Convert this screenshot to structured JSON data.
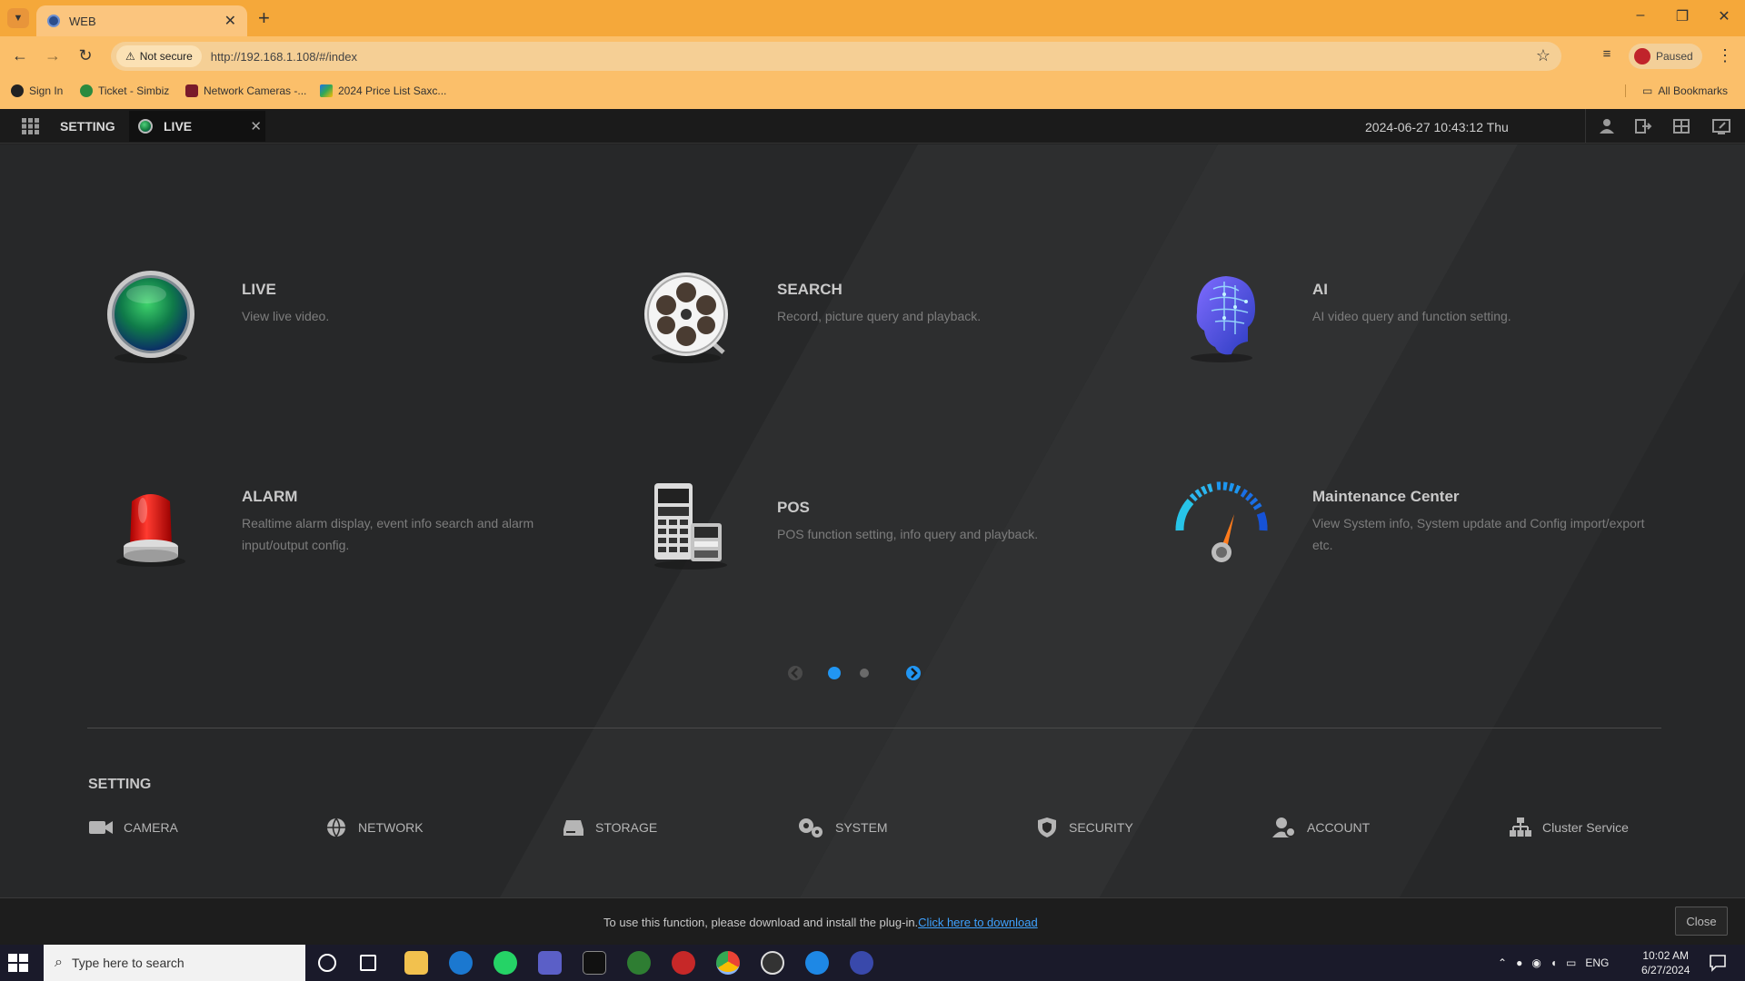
{
  "browser": {
    "tab_title": "WEB",
    "tab_close": "✕",
    "new_tab": "+",
    "window_controls": [
      "–",
      "❐",
      "✕"
    ],
    "security_label": "Not secure",
    "url": "http://192.168.1.108/#/index",
    "profile_status": "Paused",
    "bookmarks": [
      "Sign In",
      "Ticket - Simbiz",
      "Network Cameras -...",
      "2024 Price List Saxc..."
    ],
    "all_bookmarks": "All Bookmarks"
  },
  "app": {
    "setting_link": "SETTING",
    "open_tab": "LIVE",
    "open_tab_close": "✕",
    "datetime": "2024-06-27 10:43:12 Thu"
  },
  "modules": [
    {
      "title": "LIVE",
      "desc": "View live video.",
      "icon": "live-globe-icon"
    },
    {
      "title": "SEARCH",
      "desc": "Record, picture query and playback.",
      "icon": "film-reel-icon"
    },
    {
      "title": "AI",
      "desc": "AI video query and function setting.",
      "icon": "ai-brain-icon"
    },
    {
      "title": "ALARM",
      "desc": "Realtime alarm display, event info search and alarm input/output config.",
      "icon": "alarm-beacon-icon"
    },
    {
      "title": "POS",
      "desc": "POS function setting, info query and playback.",
      "icon": "pos-terminal-icon"
    },
    {
      "title": "Maintenance Center",
      "desc": "View System info, System update and Config import/export etc.",
      "icon": "gauge-icon"
    }
  ],
  "pager": {
    "pages": 2,
    "current": 1
  },
  "settings": {
    "heading": "SETTING",
    "items": [
      {
        "label": "CAMERA",
        "icon": "camera-icon"
      },
      {
        "label": "NETWORK",
        "icon": "globe-icon"
      },
      {
        "label": "STORAGE",
        "icon": "storage-icon"
      },
      {
        "label": "SYSTEM",
        "icon": "gears-icon"
      },
      {
        "label": "SECURITY",
        "icon": "shield-icon"
      },
      {
        "label": "ACCOUNT",
        "icon": "account-icon"
      },
      {
        "label": "Cluster Service",
        "icon": "cluster-icon"
      }
    ]
  },
  "plugin": {
    "message": "To use this function, please download and install the plug-in.",
    "link": "Click here to download",
    "close": "Close"
  },
  "taskbar": {
    "search_placeholder": "Type here to search",
    "language": "ENG",
    "time": "10:02 AM",
    "date": "6/27/2024"
  },
  "colors": {
    "browser_accent": "#f5a83a",
    "app_background": "#272829",
    "link": "#3fa2ff",
    "pager_active": "#2196f3"
  }
}
